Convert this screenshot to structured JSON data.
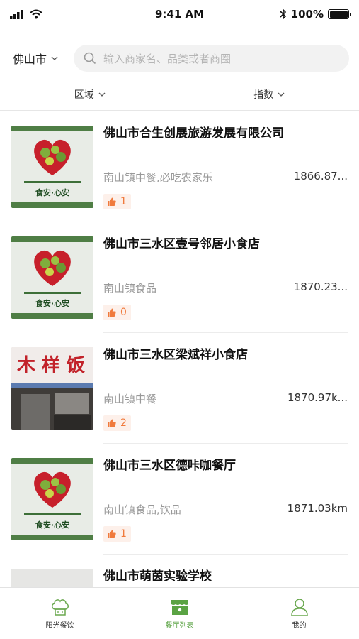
{
  "status_bar": {
    "time": "9:41 AM",
    "battery": "100%"
  },
  "header": {
    "city": "佛山市",
    "search_placeholder": "输入商家名、品类或者商圈"
  },
  "filters": [
    {
      "label": "区域"
    },
    {
      "label": "指数"
    }
  ],
  "restaurants": [
    {
      "name": "佛山市合生创展旅游发展有限公司",
      "category": "南山镇中餐,必吃农家乐",
      "distance": "1866.87...",
      "likes": "1",
      "thumb": "heart-logo"
    },
    {
      "name": "佛山市三水区壹号邻居小食店",
      "category": "南山镇食品",
      "distance": "1870.23...",
      "likes": "0",
      "thumb": "heart-logo"
    },
    {
      "name": "佛山市三水区梁斌祥小食店",
      "category": "南山镇中餐",
      "distance": "1870.97k...",
      "likes": "2",
      "thumb": "storefront-photo"
    },
    {
      "name": "佛山市三水区德咔咖餐厅",
      "category": "南山镇食品,饮品",
      "distance": "1871.03km",
      "likes": "1",
      "thumb": "heart-logo"
    },
    {
      "name": "佛山市萌茵实验学校",
      "category": "",
      "distance": "",
      "likes": "",
      "thumb": "photo"
    }
  ],
  "heart_logo": {
    "caption": "食安·心安"
  },
  "tabs": [
    {
      "label": "阳光餐饮",
      "icon": "chef-hat-icon",
      "active": false
    },
    {
      "label": "餐厅列表",
      "icon": "shop-icon",
      "active": true
    },
    {
      "label": "我的",
      "icon": "person-icon",
      "active": false
    }
  ],
  "colors": {
    "accent": "#5aa343",
    "likes": "#f07a3c",
    "likes_bg": "#fdf0ea"
  }
}
